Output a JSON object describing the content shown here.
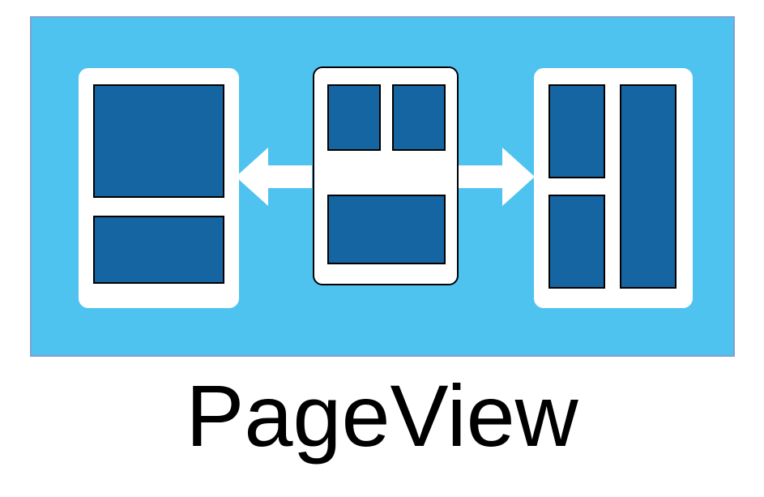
{
  "caption": "PageView",
  "colors": {
    "panel_bg": "#4FC3EF",
    "card_bg": "#ffffff",
    "chip_fill": "#1565A3",
    "arrow_fill": "#ffffff"
  },
  "cards": {
    "left": {
      "layout": "big-top-small-bottom"
    },
    "center": {
      "layout": "two-top-one-bottom"
    },
    "right": {
      "layout": "small-left-tall-right"
    }
  }
}
